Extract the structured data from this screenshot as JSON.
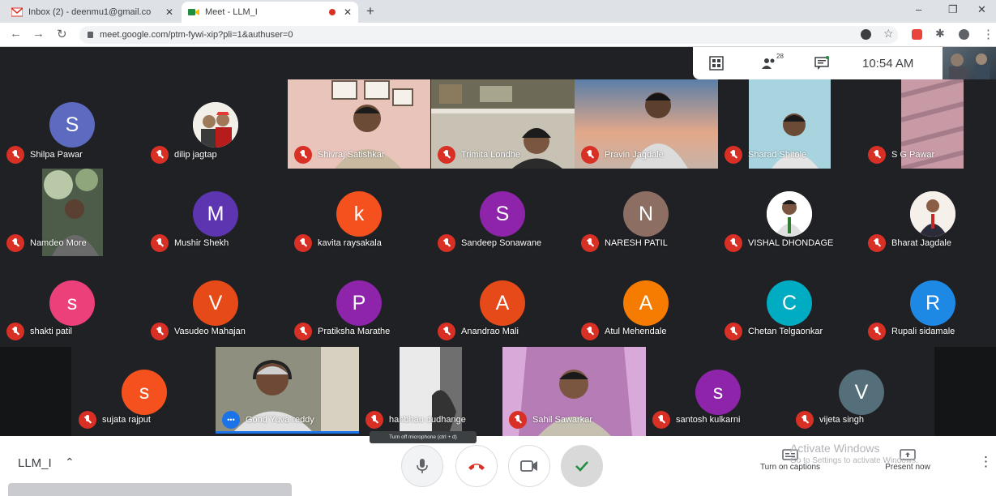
{
  "browser": {
    "tabs": [
      {
        "title": "Inbox (2) - deenmu1@gmail.co",
        "active": false
      },
      {
        "title": "Meet - LLM_I",
        "active": true
      }
    ],
    "url": "meet.google.com/ptm-fywi-xip?pli=1&authuser=0"
  },
  "meeting": {
    "time": "10:54 AM",
    "participant_count_badge": "28",
    "code": "LLM_I",
    "tooltip": "Turn off microphone (ctrl + d)",
    "captions_label": "Turn on captions",
    "present_label": "Present now",
    "watermark_title": "Activate Windows",
    "watermark_sub": "Go to Settings to activate Windows."
  },
  "colors": {
    "grid_bg": "#202124",
    "muted_red": "#d93025",
    "meet_blue": "#1a73e8",
    "accent_green": "#1e8e3e"
  },
  "participants": [
    {
      "name": "Shilpa Pawar",
      "type": "avatar",
      "initial": "S",
      "color": "#5c6bc0"
    },
    {
      "name": "dilip jagtap",
      "type": "photo"
    },
    {
      "name": "Shivraj Satishkar",
      "type": "video"
    },
    {
      "name": "Trimita Londhe",
      "type": "video"
    },
    {
      "name": "Pravin Jagdale",
      "type": "video"
    },
    {
      "name": "Sharad Shitole",
      "type": "video"
    },
    {
      "name": "S G Pawar",
      "type": "video"
    },
    {
      "name": "Namdeo More",
      "type": "video"
    },
    {
      "name": "Mushir Shekh",
      "type": "avatar",
      "initial": "M",
      "color": "#5e35b1"
    },
    {
      "name": "kavita raysakala",
      "type": "avatar",
      "initial": "k",
      "color": "#f4511e"
    },
    {
      "name": "Sandeep Sonawane",
      "type": "avatar",
      "initial": "S",
      "color": "#8e24aa"
    },
    {
      "name": "NARESH PATIL",
      "type": "avatar",
      "initial": "N",
      "color": "#8d6e63"
    },
    {
      "name": "VISHAL DHONDAGE",
      "type": "photo"
    },
    {
      "name": "Bharat Jagdale",
      "type": "photo"
    },
    {
      "name": "shakti patil",
      "type": "avatar",
      "initial": "s",
      "color": "#ec407a"
    },
    {
      "name": "Vasudeo Mahajan",
      "type": "avatar",
      "initial": "V",
      "color": "#e64a19"
    },
    {
      "name": "Pratiksha Marathe",
      "type": "avatar",
      "initial": "P",
      "color": "#8e24aa"
    },
    {
      "name": "Anandrao Mali",
      "type": "avatar",
      "initial": "A",
      "color": "#e64a19"
    },
    {
      "name": "Atul Mehendale",
      "type": "avatar",
      "initial": "A",
      "color": "#f57c00"
    },
    {
      "name": "Chetan Telgaonkar",
      "type": "avatar",
      "initial": "C",
      "color": "#00acc1"
    },
    {
      "name": "Rupali sidamale",
      "type": "avatar",
      "initial": "R",
      "color": "#1e88e5"
    },
    {
      "name": "sujata rajput",
      "type": "avatar",
      "initial": "s",
      "color": "#f4511e"
    },
    {
      "name": "Gond Yuva reddy",
      "type": "video",
      "speaking": true
    },
    {
      "name": "hanbhau dudhange",
      "type": "video"
    },
    {
      "name": "Sahil Sawarkar",
      "type": "video"
    },
    {
      "name": "santosh kulkarni",
      "type": "avatar",
      "initial": "s",
      "color": "#8e24aa"
    },
    {
      "name": "vijeta singh",
      "type": "avatar",
      "initial": "V",
      "color": "#546e7a"
    }
  ]
}
